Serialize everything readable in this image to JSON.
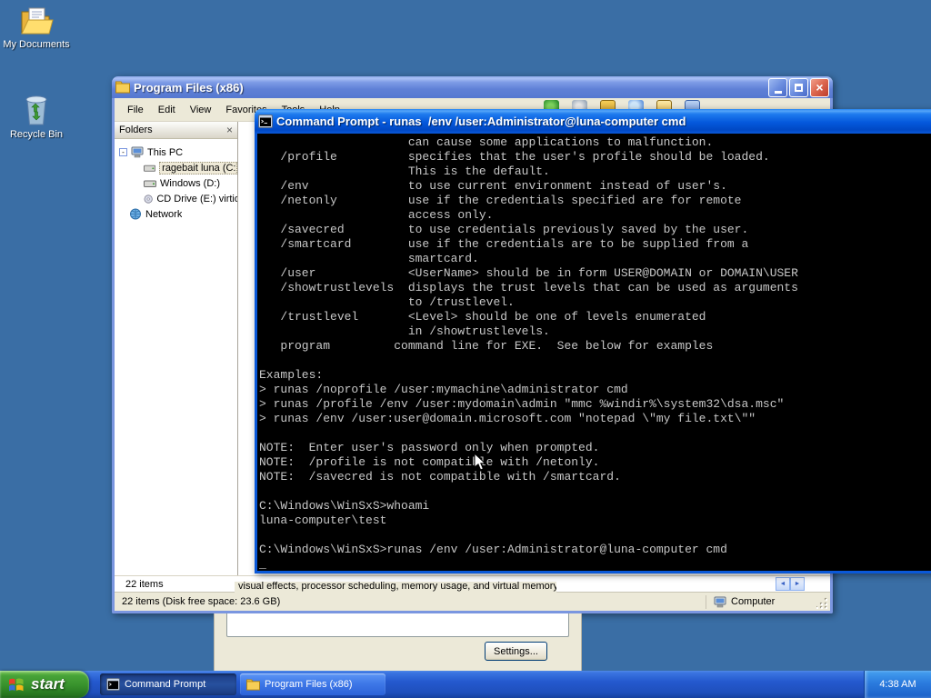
{
  "colors": {
    "desktop_bg": "#3A6EA5",
    "active_titlebar": "#0458DC",
    "inactive_titlebar": "#6B89DC",
    "taskbar_blue": "#2459CE",
    "start_green": "#37912C",
    "console_bg": "#000000",
    "console_fg": "#C7C7C7"
  },
  "desktop": {
    "icons": [
      {
        "label": "My Documents"
      },
      {
        "label": "Recycle Bin"
      }
    ]
  },
  "explorer": {
    "title": "Program Files (x86)",
    "menu": [
      "File",
      "Edit",
      "View",
      "Favorites",
      "Tools",
      "Help"
    ],
    "folders_header": "Folders",
    "folders_close": "×",
    "tree": [
      {
        "label": "This PC"
      },
      {
        "label": "ragebait luna (C:)"
      },
      {
        "label": "Windows (D:)"
      },
      {
        "label": "CD Drive (E:) virtio-win"
      },
      {
        "label": "Network"
      }
    ],
    "items_count": "22 items",
    "status_left": "22 items (Disk free space: 23.6 GB)",
    "status_right": "Computer"
  },
  "dialog": {
    "performance_text": "visual effects, processor scheduling, memory usage, and virtual memory",
    "settings_button": "Settings..."
  },
  "cmd": {
    "title": "Command Prompt - runas  /env /user:Administrator@luna-computer cmd",
    "text": "                     can cause some applications to malfunction.\n   /profile          specifies that the user's profile should be loaded.\n                     This is the default.\n   /env              to use current environment instead of user's.\n   /netonly          use if the credentials specified are for remote\n                     access only.\n   /savecred         to use credentials previously saved by the user.\n   /smartcard        use if the credentials are to be supplied from a\n                     smartcard.\n   /user             <UserName> should be in form USER@DOMAIN or DOMAIN\\USER\n   /showtrustlevels  displays the trust levels that can be used as arguments\n                     to /trustlevel.\n   /trustlevel       <Level> should be one of levels enumerated\n                     in /showtrustlevels.\n   program         command line for EXE.  See below for examples\n\nExamples:\n> runas /noprofile /user:mymachine\\administrator cmd\n> runas /profile /env /user:mydomain\\admin \"mmc %windir%\\system32\\dsa.msc\"\n> runas /env /user:user@domain.microsoft.com \"notepad \\\"my file.txt\\\"\"\n\nNOTE:  Enter user's password only when prompted.\nNOTE:  /profile is not compatible with /netonly.\nNOTE:  /savecred is not compatible with /smartcard.\n\nC:\\Windows\\WinSxS>whoami\nluna-computer\\test\n\nC:\\Windows\\WinSxS>runas /env /user:Administrator@luna-computer cmd\n_"
  },
  "taskbar": {
    "start_label": "start",
    "buttons": [
      {
        "label": "Command Prompt"
      },
      {
        "label": "Program Files (x86)"
      }
    ],
    "clock": "4:38 AM"
  }
}
